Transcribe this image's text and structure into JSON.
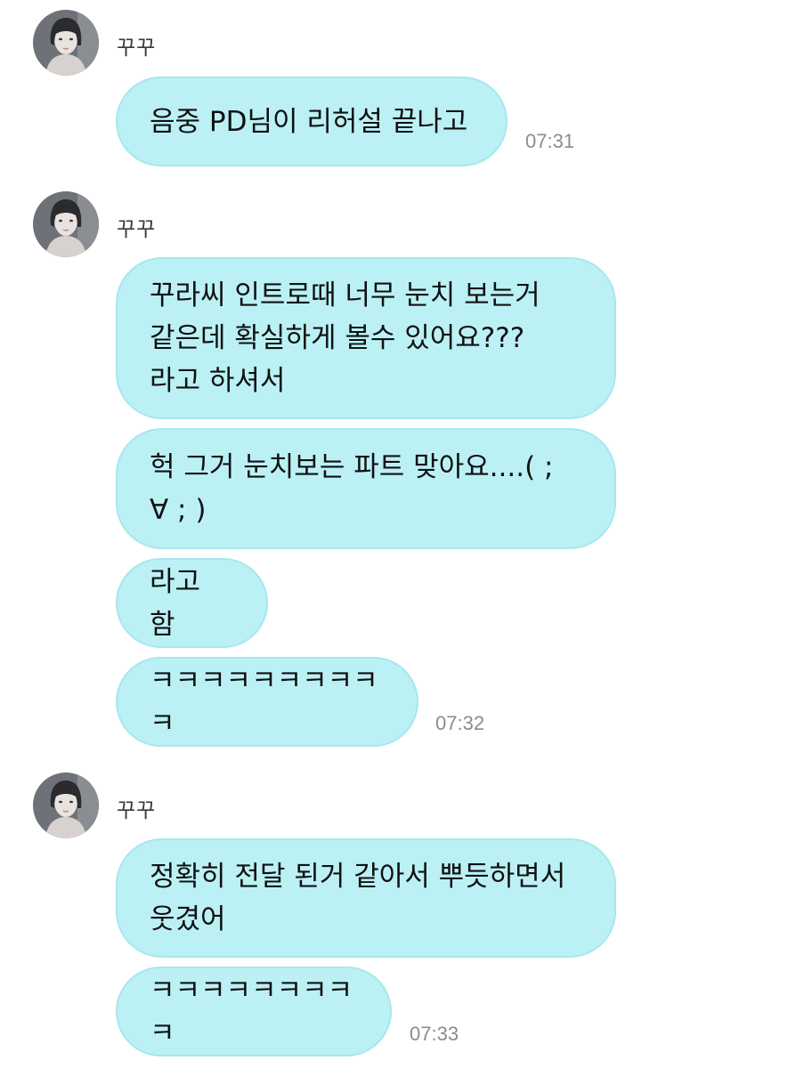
{
  "groups": [
    {
      "sender": "꾸꾸",
      "messages": [
        {
          "text": "음중 PD님이 리허설 끝나고"
        }
      ],
      "time": "07:31"
    },
    {
      "sender": "꾸꾸",
      "messages": [
        {
          "text": "꾸라씨 인트로때 너무 눈치 보는거\n같은데 확실하게 볼수 있어요???\n라고 하셔서"
        },
        {
          "text": "헉 그거 눈치보는 파트 맞아요....( ;\n∀ ; )"
        },
        {
          "text": "라고 함"
        },
        {
          "text": "ㅋㅋㅋㅋㅋㅋㅋㅋㅋㅋ"
        }
      ],
      "time": "07:32"
    },
    {
      "sender": "꾸꾸",
      "messages": [
        {
          "text": "정확히 전달 된거 같아서 뿌듯하면서\n웃겼어"
        },
        {
          "text": "ㅋㅋㅋㅋㅋㅋㅋㅋㅋ"
        }
      ],
      "time": "07:33"
    }
  ],
  "colors": {
    "bubble": "#bbf1f5",
    "bubble_border": "#a7e7ee",
    "time": "#8c8c8c",
    "background": "#ffffff"
  },
  "icons": {
    "avatar": "profile-photo-icon"
  }
}
